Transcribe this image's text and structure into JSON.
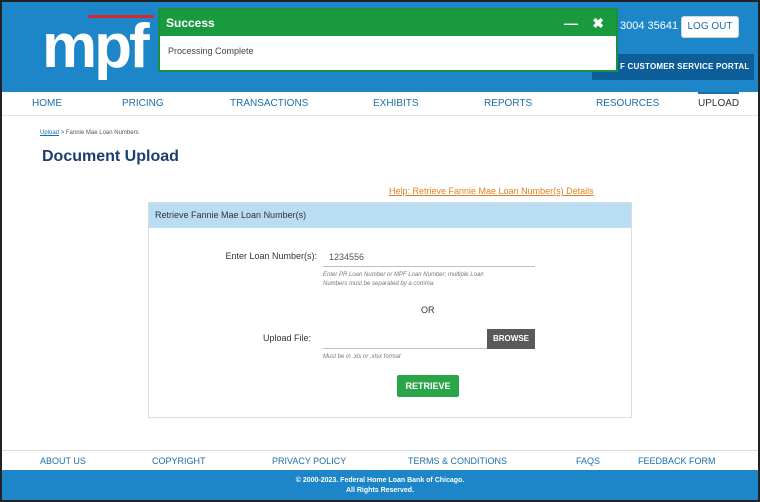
{
  "header": {
    "logo": "mpf",
    "phone": "3004 35641",
    "logout_label": "LOG OUT",
    "portal_link": "F CUSTOMER SERVICE PORTAL"
  },
  "toast": {
    "title": "Success",
    "message": "Processing Complete",
    "minimize": "—",
    "close": "✖"
  },
  "nav": {
    "items": [
      "HOME",
      "PRICING",
      "TRANSACTIONS",
      "EXHIBITS",
      "REPORTS",
      "RESOURCES",
      "UPLOAD"
    ],
    "active": "UPLOAD"
  },
  "breadcrumb": {
    "link": "Upload",
    "separator": ">",
    "current": "Fannie Mae Loan Numbers"
  },
  "page": {
    "title": "Document Upload",
    "help_link": "Help: Retrieve Fannie Mae Loan Number(s) Details"
  },
  "panel": {
    "header": "Retrieve Fannie Mae Loan Number(s)",
    "loan_label": "Enter Loan Number(s):",
    "loan_value": "1234556",
    "loan_hint_line1": "Enter PR Loan Number or MPF Loan Number; multiple Loan",
    "loan_hint_line2": "Numbers must be separated by a comma.",
    "or_text": "OR",
    "upload_label": "Upload File:",
    "browse_label": "BROWSE",
    "upload_hint": "Must be in .xls or .xlsx format",
    "retrieve_label": "RETRIEVE"
  },
  "footer": {
    "items": [
      "ABOUT US",
      "COPYRIGHT",
      "PRIVACY POLICY",
      "TERMS & CONDITIONS",
      "FAQS",
      "FEEDBACK FORM"
    ],
    "copyright_line1": "© 2000-2023. Federal Home Loan Bank of Chicago.",
    "copyright_line2": "All Rights Reserved."
  },
  "colors": {
    "brand_blue": "#1c86c8",
    "success_green": "#1a9a3f",
    "help_orange": "#e08022",
    "panel_header": "#b9ddf2"
  }
}
